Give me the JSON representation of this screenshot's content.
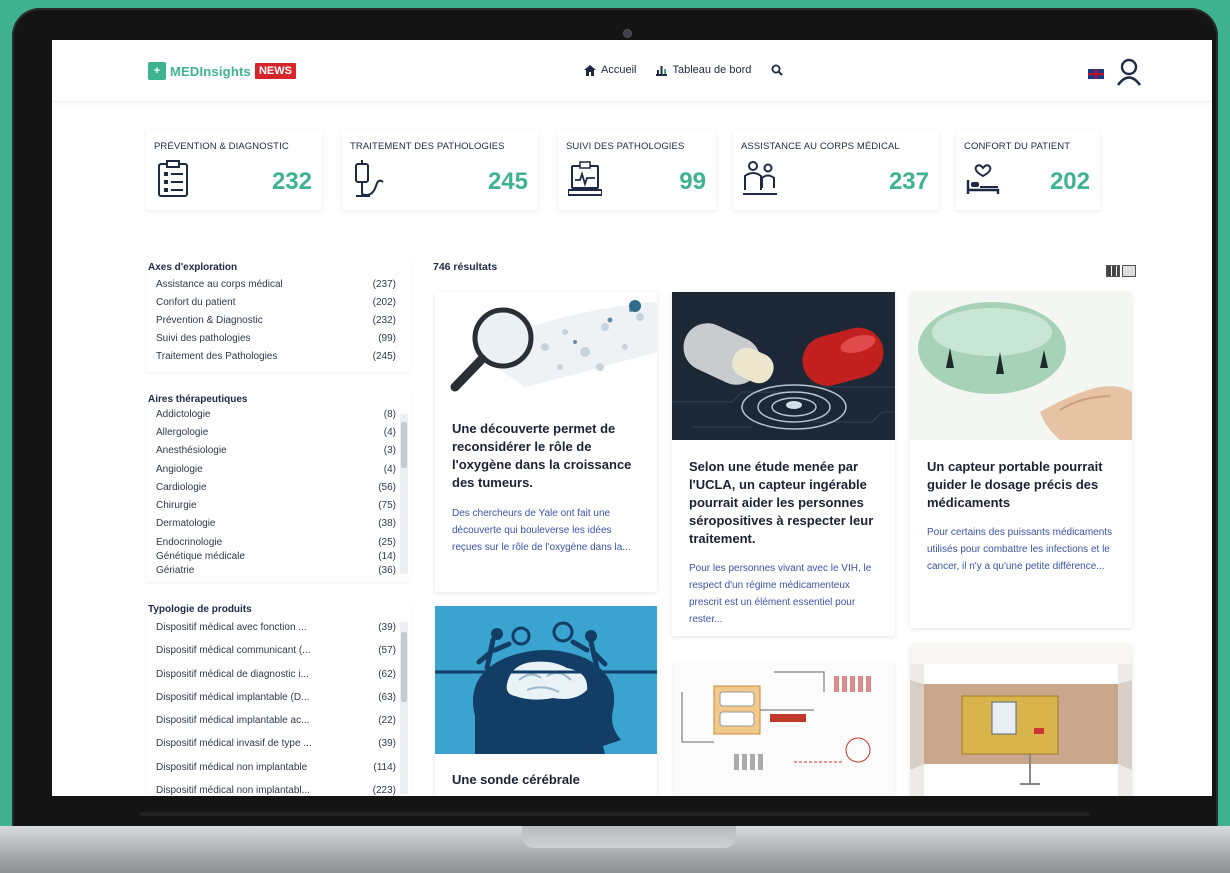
{
  "header": {
    "logo_text": "MEDInsights",
    "logo_badge": "NEWS",
    "nav": [
      {
        "label": "Accueil",
        "icon": "home-icon"
      },
      {
        "label": "Tableau de bord",
        "icon": "dashboard-icon"
      }
    ],
    "language_flag": "uk-flag-icon"
  },
  "categories": [
    {
      "label": "PRÉVENTION & DIAGNOSTIC",
      "count": "232",
      "icon": "clipboard-icon"
    },
    {
      "label": "TRAITEMENT DES PATHOLOGIES",
      "count": "245",
      "icon": "iv-drip-icon"
    },
    {
      "label": "SUIVI DES PATHOLOGIES",
      "count": "99",
      "icon": "monitor-icon"
    },
    {
      "label": "ASSISTANCE AU CORPS MÉDICAL",
      "count": "237",
      "icon": "doctors-icon"
    },
    {
      "label": "CONFORT DU PATIENT",
      "count": "202",
      "icon": "bed-icon"
    }
  ],
  "filters": {
    "axes": {
      "title": "Axes d'exploration",
      "items": [
        {
          "label": "Assistance au corps médical",
          "count": "(237)"
        },
        {
          "label": "Confort du patient",
          "count": "(202)"
        },
        {
          "label": "Prévention & Diagnostic",
          "count": "(232)"
        },
        {
          "label": "Suivi des pathologies",
          "count": "(99)"
        },
        {
          "label": "Traitement des Pathologies",
          "count": "(245)"
        }
      ]
    },
    "aires": {
      "title": "Aires thérapeutiques",
      "items": [
        {
          "label": "Addictologie",
          "count": "(8)"
        },
        {
          "label": "Allergologie",
          "count": "(4)"
        },
        {
          "label": "Anesthésiologie",
          "count": "(3)"
        },
        {
          "label": "Angiologie",
          "count": "(4)"
        },
        {
          "label": "Cardiologie",
          "count": "(56)"
        },
        {
          "label": "Chirurgie",
          "count": "(75)"
        },
        {
          "label": "Dermatologie",
          "count": "(38)"
        },
        {
          "label": "Endocrinologie",
          "count": "(25)"
        },
        {
          "label": "Génétique médicale",
          "count": "(14)"
        },
        {
          "label": "Gériatrie",
          "count": "(36)"
        }
      ]
    },
    "typologie": {
      "title": "Typologie de produits",
      "items": [
        {
          "label": "Dispositif médical avec fonction ...",
          "count": "(39)"
        },
        {
          "label": "Dispositif médical communicant (...",
          "count": "(57)"
        },
        {
          "label": "Dispositif médical de diagnostic i...",
          "count": "(62)"
        },
        {
          "label": "Dispositif médical implantable (D...",
          "count": "(63)"
        },
        {
          "label": "Dispositif médical implantable ac...",
          "count": "(22)"
        },
        {
          "label": "Dispositif médical invasif de type ...",
          "count": "(39)"
        },
        {
          "label": "Dispositif médical non implantable",
          "count": "(114)"
        },
        {
          "label": "Dispositif médical non implantabl...",
          "count": "(223)"
        }
      ]
    }
  },
  "results": {
    "count_label": "746 résultats",
    "cards": [
      {
        "title": "Une découverte permet de reconsidérer le rôle de l'oxygène dans la croissance des tumeurs.",
        "excerpt": "Des chercheurs de Yale ont fait une découverte qui bouleverse les idées reçues sur le rôle de l'oxygène dans la..."
      },
      {
        "title": "Selon une étude menée par l'UCLA, un capteur ingérable pourrait aider les personnes séropositives à respecter leur traitement.",
        "excerpt": "Pour les personnes vivant avec le VIH, le respect d'un régime médicamenteux prescrit est un élément essentiel pour rester..."
      },
      {
        "title": "Un capteur portable pourrait guider le dosage précis des médicaments",
        "excerpt": "Pour certains des puissants médicaments utilisés pour combattre les infections et le cancer, il n'y a qu'une petite différence..."
      },
      {
        "title": "Une sonde cérébrale",
        "excerpt": ""
      }
    ]
  },
  "colors": {
    "accent": "#3fb38f",
    "brand_red": "#d7262b",
    "navy": "#1e2a44",
    "link_blue": "#3c55a5"
  }
}
